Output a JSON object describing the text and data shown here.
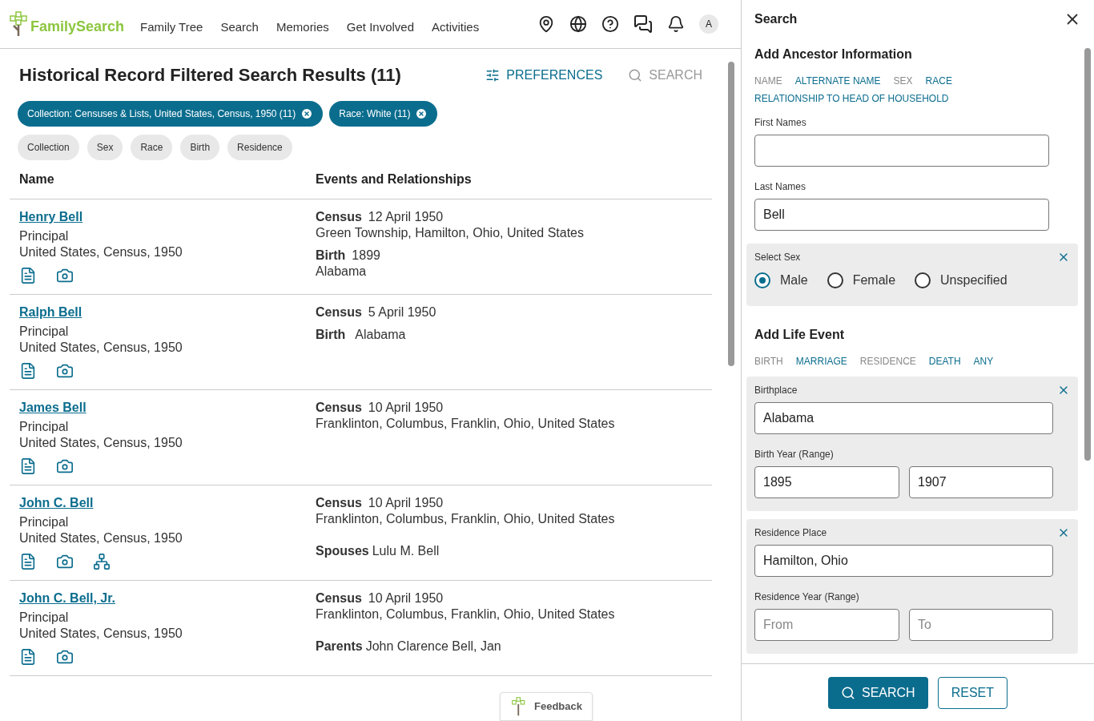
{
  "nav": {
    "logo": "FamilySearch",
    "items": [
      "Family Tree",
      "Search",
      "Memories",
      "Get Involved",
      "Activities"
    ],
    "avatar": "A"
  },
  "results": {
    "title": "Historical Record Filtered Search Results (11)",
    "preferences": "PREFERENCES",
    "search": "SEARCH",
    "active_filters": [
      "Collection: Censuses & Lists, United States, Census, 1950 (11)",
      "Race: White (11)"
    ],
    "filter_buttons": [
      "Collection",
      "Sex",
      "Race",
      "Birth",
      "Residence"
    ],
    "columns": [
      "Name",
      "Events and Relationships"
    ],
    "rows": [
      {
        "name": "Henry Bell",
        "role": "Principal",
        "collection": "United States, Census, 1950",
        "tree_link": false,
        "events": [
          {
            "label": "Census",
            "date": "12 April 1950",
            "place": "Green Township, Hamilton, Ohio, United States"
          },
          {
            "label": "Birth",
            "date": "1899",
            "place": "Alabama"
          }
        ],
        "relationships": []
      },
      {
        "name": "Ralph Bell",
        "role": "Principal",
        "collection": "United States, Census, 1950",
        "tree_link": false,
        "events": [
          {
            "label": "Census",
            "date": "5 April 1950"
          },
          {
            "label": "Birth",
            "place": "Alabama"
          }
        ],
        "relationships": []
      },
      {
        "name": "James Bell",
        "role": "Principal",
        "collection": "United States, Census, 1950",
        "tree_link": false,
        "events": [
          {
            "label": "Census",
            "date": "10 April 1950",
            "place": "Franklinton, Columbus, Franklin, Ohio, United States"
          }
        ],
        "relationships": []
      },
      {
        "name": "John C. Bell",
        "role": "Principal",
        "collection": "United States, Census, 1950",
        "tree_link": true,
        "events": [
          {
            "label": "Census",
            "date": "10 April 1950",
            "place": "Franklinton, Columbus, Franklin, Ohio, United States"
          }
        ],
        "relationships": [
          {
            "label": "Spouses",
            "names": "Lulu M. Bell"
          }
        ]
      },
      {
        "name": "John C. Bell, Jr.",
        "role": "Principal",
        "collection": "United States, Census, 1950",
        "tree_link": false,
        "events": [
          {
            "label": "Census",
            "date": "10 April 1950",
            "place": "Franklinton, Columbus, Franklin, Ohio, United States"
          }
        ],
        "relationships": [
          {
            "label": "Parents",
            "names": "John Clarence Bell, Jan"
          }
        ]
      }
    ],
    "feedback": "Feedback"
  },
  "search_panel": {
    "title": "Search",
    "ancestor": {
      "heading": "Add Ancestor Information",
      "options": [
        {
          "label": "NAME",
          "added": true
        },
        {
          "label": "ALTERNATE NAME",
          "added": false
        },
        {
          "label": "SEX",
          "added": true
        },
        {
          "label": "RACE",
          "added": false
        },
        {
          "label": "RELATIONSHIP TO HEAD OF HOUSEHOLD",
          "added": false
        }
      ],
      "first_names": {
        "label": "First Names"
      },
      "last_names": {
        "label": "Last Names",
        "value": "Bell"
      },
      "sex": {
        "label": "Select Sex",
        "options": [
          {
            "label": "Male",
            "selected": true
          },
          {
            "label": "Female",
            "selected": false
          },
          {
            "label": "Unspecified",
            "selected": false
          }
        ]
      }
    },
    "life_event": {
      "heading": "Add Life Event",
      "options": [
        {
          "label": "BIRTH",
          "added": true
        },
        {
          "label": "MARRIAGE",
          "added": false
        },
        {
          "label": "RESIDENCE",
          "added": true
        },
        {
          "label": "DEATH",
          "added": false
        },
        {
          "label": "ANY",
          "added": false
        }
      ],
      "groups": [
        {
          "place_label": "Birthplace",
          "place": "Alabama",
          "year_label": "Birth Year (Range)",
          "from": {
            "value": "1895"
          },
          "to": {
            "value": "1907"
          }
        },
        {
          "place_label": "Residence Place",
          "place": "Hamilton, Ohio",
          "year_label": "Residence Year (Range)",
          "from": {
            "placeholder": "From"
          },
          "to": {
            "placeholder": "To"
          }
        }
      ]
    },
    "buttons": {
      "search": "SEARCH",
      "reset": "RESET"
    }
  }
}
